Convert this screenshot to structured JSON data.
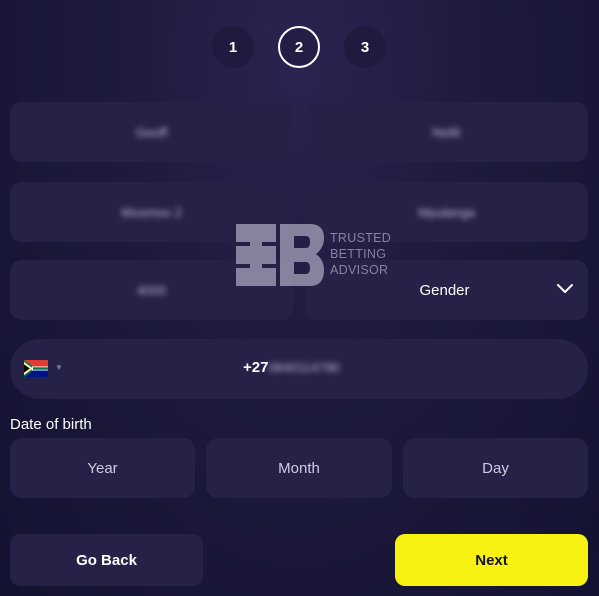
{
  "stepper": {
    "steps": [
      "1",
      "2",
      "3"
    ],
    "active_step": "2"
  },
  "form": {
    "first_name": "Geoff",
    "last_name": "Nelili",
    "address": "Mosmoo 2",
    "city": "Mpulanga",
    "postal_code": "4000",
    "gender": {
      "label": "Gender",
      "icon": "chevron-down-icon"
    },
    "phone": {
      "country_flag": "south-africa-flag-icon",
      "prefix": "+27",
      "number": "0840114790"
    },
    "dob": {
      "label": "Date of birth",
      "year": "Year",
      "month": "Month",
      "day": "Day"
    }
  },
  "buttons": {
    "back_label": "Go Back",
    "next_label": "Next"
  },
  "watermark": {
    "line1": "TRUSTED",
    "line2": "BETTING",
    "line3": "ADVISOR"
  },
  "colors": {
    "background": "#1d1a3d",
    "field": "#252147",
    "accent": "#f8f213"
  }
}
